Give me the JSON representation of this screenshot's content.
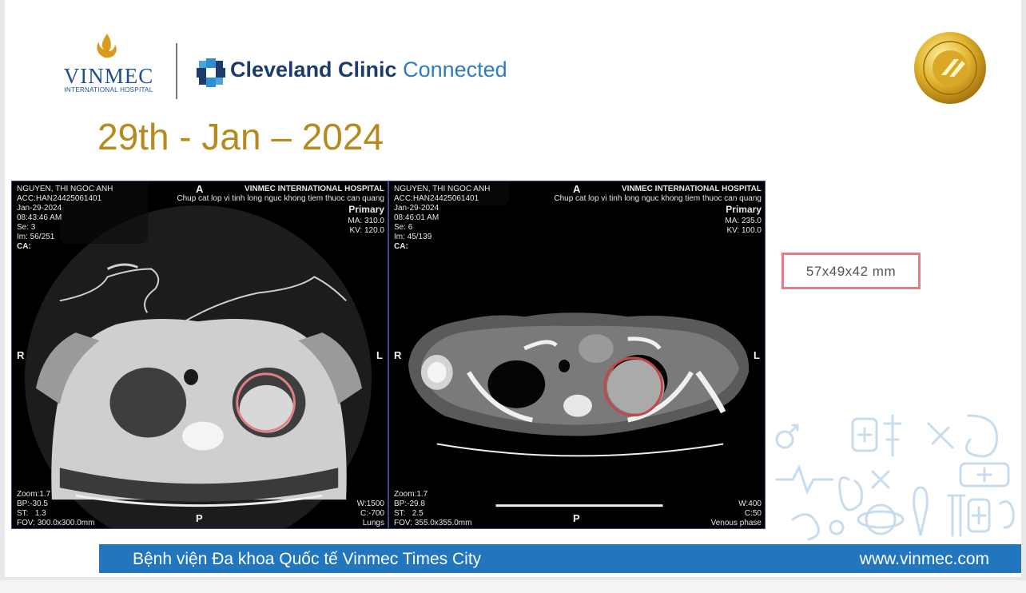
{
  "header": {
    "vinmec_name": "VINMEC",
    "vinmec_subtitle": "INTERNATIONAL HOSPITAL",
    "partner_bold": "Cleveland Clinic",
    "partner_light": "Connected",
    "date_title": "29th - Jan – 2024"
  },
  "viewers": [
    {
      "patient": "NGUYEN, THI NGOC ANH",
      "acc": "ACC:HAN24425061401",
      "date": "Jan-29-2024",
      "time": "08:43:46 AM",
      "se": "Se: 3",
      "im": "Im: 56/251",
      "ca": "CA:",
      "hospital": "VINMEC INTERNATIONAL HOSPITAL",
      "study": "Chup cat lop vi tinh long nguc khong tiem thuoc can quang",
      "series": "Primary",
      "ma": "MA: 310.0",
      "kv": "KV: 120.0",
      "top_marker": "A",
      "left_marker": "R",
      "right_marker": "L",
      "bottom_marker": "P",
      "zoom": "Zoom:1.7",
      "bp": "BP:-30.5",
      "st": "ST:   1.3",
      "fov": "FOV: 300.0x300.0mm",
      "w": "W:1500",
      "c": "C:-700",
      "window": "Lungs"
    },
    {
      "patient": "NGUYEN, THI NGOC ANH",
      "acc": "ACC:HAN24425061401",
      "date": "Jan-29-2024",
      "time": "08:46:01 AM",
      "se": "Se: 6",
      "im": "Im: 45/139",
      "ca": "CA:",
      "hospital": "VINMEC INTERNATIONAL HOSPITAL",
      "study": "Chup cat lop vi tinh long nguc khong tiem thuoc can quang",
      "series": "Primary",
      "ma": "MA: 235.0",
      "kv": "KV: 100.0",
      "top_marker": "A",
      "left_marker": "R",
      "right_marker": "L",
      "bottom_marker": "P",
      "zoom": "Zoom:1.7",
      "bp": "BP:-29.8",
      "st": "ST:   2.5",
      "fov": "FOV: 355.0x355.0mm",
      "w": "W:400",
      "c": "C:50",
      "window": "Venous phase"
    }
  ],
  "measurement": "57x49x42 mm",
  "footer": {
    "hospital": "Bệnh viện Đa khoa Quốc tế Vinmec Times City",
    "website": "www.vinmec.com"
  },
  "colors": {
    "brand_blue": "#1f4f8f",
    "footer_blue": "#2276bd",
    "date_gold": "#b68a1c",
    "highlight_red": "#e27f86"
  },
  "icons": [
    "vinmec-flame-icon",
    "cleveland-clinic-cross-icon",
    "jci-seal-icon",
    "medical-pattern-icon"
  ]
}
